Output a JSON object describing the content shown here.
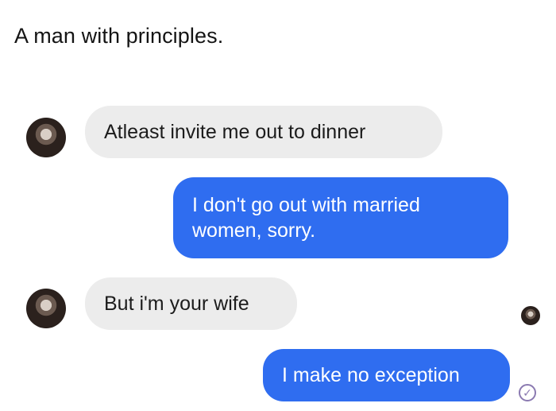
{
  "post": {
    "caption": "A man with principles."
  },
  "messages": [
    {
      "id": "m1",
      "sender": "other",
      "text": "Atleast invite me out to dinner"
    },
    {
      "id": "m2",
      "sender": "self",
      "text": "I don't go out with married\nwomen, sorry."
    },
    {
      "id": "m3",
      "sender": "other",
      "text": "But i'm your wife"
    },
    {
      "id": "m4",
      "sender": "self",
      "text": "I make no exception"
    }
  ],
  "status_icon": "check-circle-icon",
  "colors": {
    "outgoing_bubble": "#2f6df0",
    "incoming_bubble": "#ececec",
    "status": "#8b7ab1"
  }
}
